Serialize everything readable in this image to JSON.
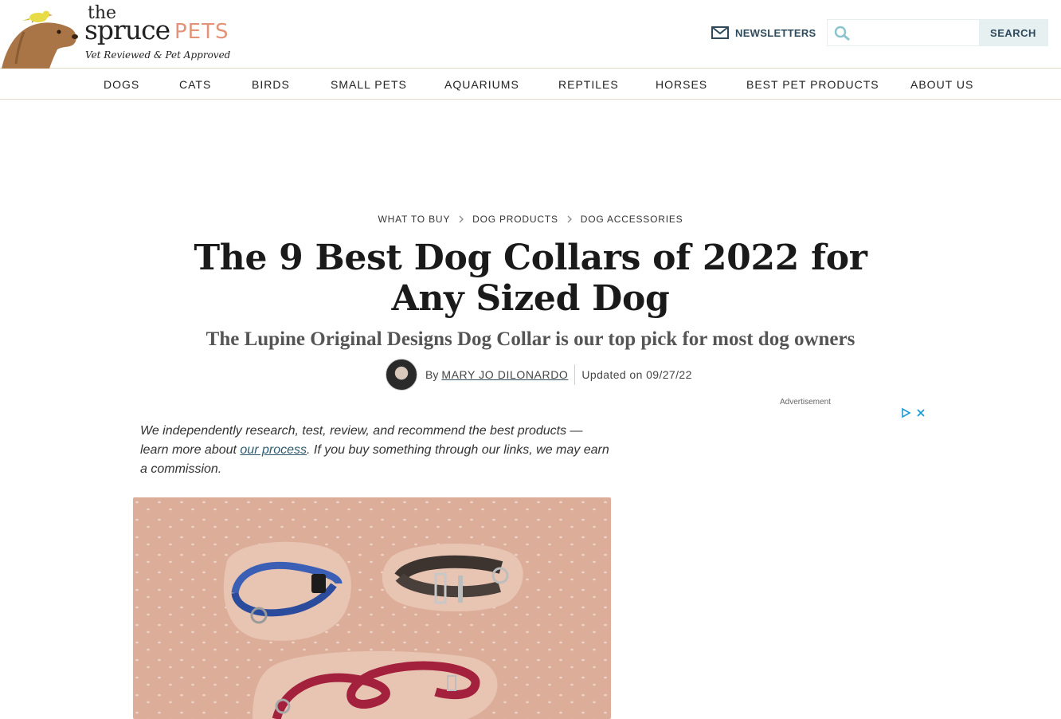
{
  "brand": {
    "the": "the",
    "spruce": "spruce",
    "pets": "PETS",
    "tagline": "Vet Reviewed & Pet Approved"
  },
  "header": {
    "newsletters_label": "NEWSLETTERS",
    "search_placeholder": "",
    "search_button": "SEARCH"
  },
  "nav": {
    "items": [
      {
        "label": "DOGS"
      },
      {
        "label": "CATS"
      },
      {
        "label": "BIRDS"
      },
      {
        "label": "SMALL PETS"
      },
      {
        "label": "AQUARIUMS"
      },
      {
        "label": "REPTILES"
      },
      {
        "label": "HORSES"
      },
      {
        "label": "BEST PET PRODUCTS"
      },
      {
        "label": "ABOUT US"
      }
    ]
  },
  "breadcrumb": [
    "WHAT TO BUY",
    "DOG PRODUCTS",
    "DOG ACCESSORIES"
  ],
  "article": {
    "title": "The 9 Best Dog Collars of 2022 for Any Sized Dog",
    "subtitle": "The Lupine Original Designs Dog Collar is our top pick for most dog owners",
    "by": "By",
    "author": "MARY JO DILONARDO",
    "updated": "Updated on 09/27/22",
    "disclaimer_before": "We independently research, test, review, and recommend the best products —learn more about ",
    "disclaimer_link": "our process",
    "disclaimer_after": ". If you buy something through our links, we may earn a commission."
  },
  "ad": {
    "label": "Advertisement"
  },
  "colors": {
    "accent": "#e2947a",
    "link": "#2e4a5c",
    "hero_bg": "#dcae9a"
  },
  "icons": [
    "dog-logo-icon",
    "bird-icon",
    "mail-icon",
    "search-icon",
    "chevron-right-icon",
    "adchoices-icon",
    "close-icon"
  ]
}
